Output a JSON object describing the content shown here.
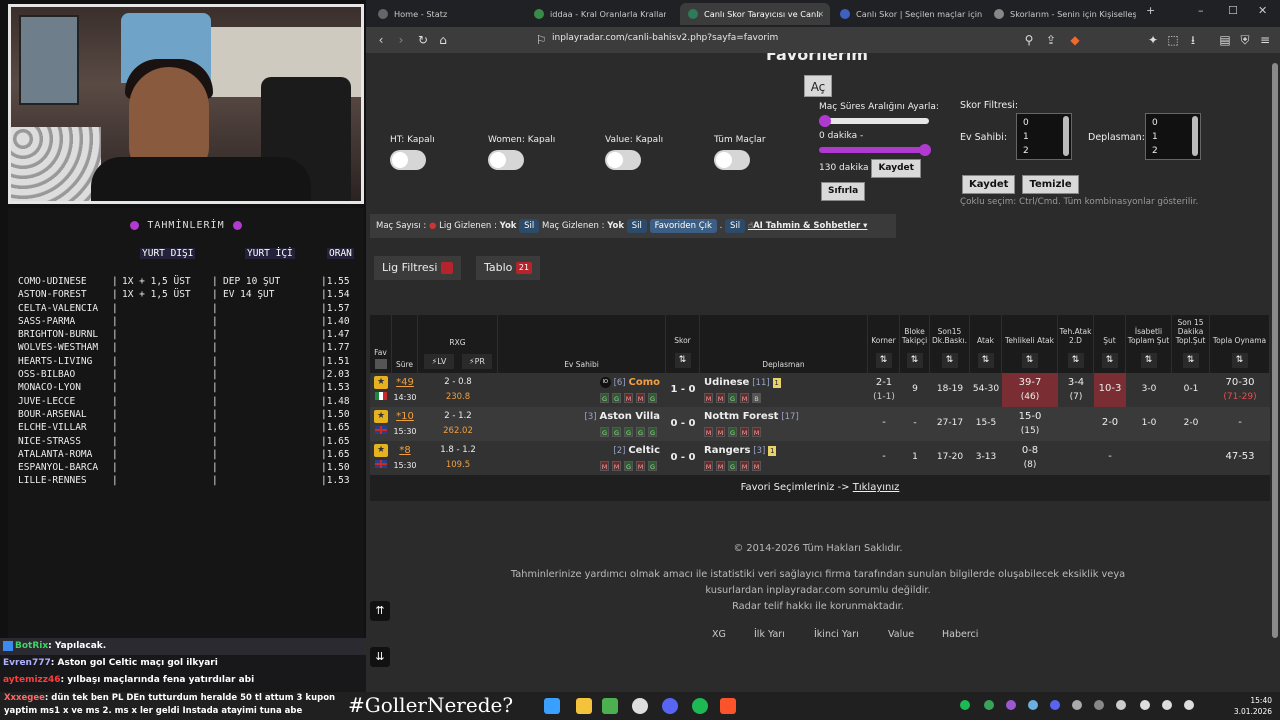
{
  "tahminlerim": {
    "title": "TAHMİNLERİM",
    "headers": {
      "yurt_disi": "YURT DIŞI",
      "yurt_ici": "YURT İÇİ",
      "oran": "ORAN"
    },
    "rows": [
      {
        "match": "COMO-UDINESE",
        "sep1": "|",
        "yd": "1X + 1,5 ÜST",
        "sep2": "|",
        "yi": "DEP 10 ŞUT",
        "oran": "|1.55"
      },
      {
        "match": "ASTON-FOREST",
        "sep1": "|",
        "yd": "1X + 1,5 ÜST",
        "sep2": "|",
        "yi": "EV 14 ŞUT",
        "oran": "|1.54"
      },
      {
        "match": "CELTA-VALENCIA",
        "sep1": "|",
        "yd": "",
        "sep2": "|",
        "yi": "",
        "oran": "|1.57"
      },
      {
        "match": "SASS-PARMA",
        "sep1": "|",
        "yd": "",
        "sep2": "|",
        "yi": "",
        "oran": "|1.40"
      },
      {
        "match": "BRIGHTON-BURNL",
        "sep1": "|",
        "yd": "",
        "sep2": "|",
        "yi": "",
        "oran": "|1.47"
      },
      {
        "match": "WOLVES-WESTHAM",
        "sep1": "|",
        "yd": "",
        "sep2": "|",
        "yi": "",
        "oran": "|1.77"
      },
      {
        "match": "HEARTS-LIVING",
        "sep1": "|",
        "yd": "",
        "sep2": "|",
        "yi": "",
        "oran": "|1.51"
      },
      {
        "match": "OSS-BILBAO",
        "sep1": "|",
        "yd": "",
        "sep2": "|",
        "yi": "",
        "oran": "|2.03"
      },
      {
        "match": "MONACO-LYON",
        "sep1": "|",
        "yd": "",
        "sep2": "|",
        "yi": "",
        "oran": "|1.53"
      },
      {
        "match": "JUVE-LECCE",
        "sep1": "|",
        "yd": "",
        "sep2": "|",
        "yi": "",
        "oran": "|1.48"
      },
      {
        "match": "BOUR-ARSENAL",
        "sep1": "|",
        "yd": "",
        "sep2": "|",
        "yi": "",
        "oran": "|1.50"
      },
      {
        "match": "ELCHE-VILLAR",
        "sep1": "|",
        "yd": "",
        "sep2": "|",
        "yi": "",
        "oran": "|1.65"
      },
      {
        "match": "NICE-STRASS",
        "sep1": "|",
        "yd": "",
        "sep2": "|",
        "yi": "",
        "oran": "|1.65"
      },
      {
        "match": "ATALANTA-ROMA",
        "sep1": "|",
        "yd": "",
        "sep2": "|",
        "yi": "",
        "oran": "|1.65"
      },
      {
        "match": "ESPANYOL-BARCA",
        "sep1": "|",
        "yd": "",
        "sep2": "|",
        "yi": "",
        "oran": "|1.50"
      },
      {
        "match": "LILLE-RENNES",
        "sep1": "|",
        "yd": "",
        "sep2": "|",
        "yi": "",
        "oran": "|1.53"
      }
    ]
  },
  "chat": [
    {
      "user": "BotRix",
      "msg": ": Yapılacak."
    },
    {
      "user": "Evren777",
      "msg": ": Aston gol Celtic maçı gol ilkyari"
    },
    {
      "user": "aytemizz46",
      "msg": ": yılbaşı maçlarında fena yatırdılar abi"
    }
  ],
  "taskbar": {
    "ticker_user": "Xxxegee",
    "ticker": ": dün tek ben PL DEn tutturdum heralde 50 tl attum 3 kupon yaptim ms1 x ve ms 2. ms x ler geldi Instada atayimi tuna abe",
    "hashtag": "#GollerNerede?",
    "time": "15:40",
    "date": "3.01.2026"
  },
  "browser": {
    "tabs": [
      {
        "label": "Home - Statz"
      },
      {
        "label": "iddaa - Kral Oranlarla Krallar Gibi"
      },
      {
        "label": "Canlı Skor Tarayıcısı ve Canlı"
      },
      {
        "label": "Canlı Skor | Seçilen maçlar için ca"
      },
      {
        "label": "Skorlarım - Senin için Kişiselleştiril"
      }
    ],
    "url": "inplayradar.com/canli-bahisv2.php?sayfa=favorim"
  },
  "page": {
    "title": "Favorilerim",
    "ac_button": "Aç",
    "toggles": [
      {
        "label": "HT: Kapalı"
      },
      {
        "label": "Women: Kapalı"
      },
      {
        "label": "Value: Kapalı"
      },
      {
        "label": "Tüm Maçlar"
      }
    ],
    "range": {
      "title": "Maç Süres Aralığını Ayarla:",
      "min_label": "0 dakika -",
      "max_label": "130 dakika",
      "min_value_min": 0,
      "max_value_min": 130,
      "save": "Kaydet",
      "reset": "Sıfırla"
    },
    "filter": {
      "title": "Skor Filtresi:",
      "home_label": "Ev Sahibi:",
      "away_label": "Deplasman:",
      "home_options": [
        "0",
        "1",
        "2"
      ],
      "away_options": [
        "0",
        "1",
        "2"
      ],
      "save": "Kaydet",
      "clear": "Temizle",
      "hint": "Çoklu seçim: Ctrl/Cmd. Tüm kombinasyonlar gösterilir."
    },
    "bar": {
      "mac_sayisi": "Maç Sayısı :",
      "lig_gizlenen": "Lig Gizlenen :",
      "lig_val": "Yok",
      "sil1": "Sil",
      "mac_gizlenen": "Maç Gizlenen :",
      "mac_val": "Yok",
      "sil2": "Sil",
      "favoriden": "Favoriden Çık",
      "dot": ".",
      "sil3": "Sil",
      "ai": "AI Tahmin & Sohbetler ▾"
    },
    "lig_filtresi": "Lig Filtresi",
    "tablo": "Tablo",
    "tablo_count": "21",
    "columns": {
      "fav": "Fav",
      "sure": "Süre",
      "rxg": "RXG",
      "lv": "LV",
      "pr": "PR",
      "ev": "Ev Sahibi",
      "skor": "Skor",
      "dep": "Deplasman",
      "korner": "Korner",
      "bloke": "Bloke Takipçi",
      "son15": "Son15 Dk.Baskı.",
      "atak": "Atak",
      "tehlikeli": "Tehlikeli Atak",
      "teh2d": "Teh.Atak 2.D",
      "sut": "Şut",
      "isabetli": "İsabetli Toplam Şut",
      "son15sut": "Son 15 Dakika Topl.Şut",
      "topla": "Topla Oynama"
    },
    "matches": [
      {
        "minute": "49",
        "time": "14:30",
        "rxg": "2 - 0.8",
        "xg": "230.8",
        "home": "Como",
        "home_rank": "[6]",
        "score": "1 - 0",
        "away": "Udinese",
        "away_rank": "[11]",
        "away_card": "1",
        "home_form": [
          "G",
          "G",
          "M",
          "M",
          "G"
        ],
        "away_form": [
          "M",
          "M",
          "G",
          "M",
          "B"
        ],
        "korner": "2-1",
        "korner_ht": "(1-1)",
        "bloke": "9",
        "son15": "18-19",
        "atak": "54-30",
        "tehlikeli": "39-7",
        "tehlikeli_ht": "(46)",
        "teh2d": "3-4",
        "teh2d_ht": "(7)",
        "sut": "10-3",
        "isabetli": "3-0",
        "son15sut": "0-1",
        "topla": "70-30",
        "topla_ht": "(71-29)"
      },
      {
        "minute": "10",
        "time": "15:30",
        "rxg": "2 - 1.2",
        "xg": "262.02",
        "home": "Aston Villa",
        "home_rank": "[3]",
        "score": "0 - 0",
        "away": "Nottm Forest",
        "away_rank": "[17]",
        "away_card": "",
        "home_form": [
          "G",
          "G",
          "G",
          "G",
          "G"
        ],
        "away_form": [
          "M",
          "M",
          "G",
          "M",
          "M"
        ],
        "korner": "-",
        "korner_ht": "",
        "bloke": "-",
        "son15": "27-17",
        "atak": "15-5",
        "tehlikeli": "15-0",
        "tehlikeli_ht": "(15)",
        "teh2d": "",
        "teh2d_ht": "",
        "sut": "2-0",
        "isabetli": "1-0",
        "son15sut": "2-0",
        "topla": "-",
        "topla_ht": ""
      },
      {
        "minute": "8",
        "time": "15:30",
        "rxg": "1.8 - 1.2",
        "xg": "109.5",
        "home": "Celtic",
        "home_rank": "[2]",
        "score": "0 - 0",
        "away": "Rangers",
        "away_rank": "[3]",
        "away_card": "1",
        "home_form": [
          "M",
          "M",
          "G",
          "M",
          "G"
        ],
        "away_form": [
          "M",
          "M",
          "G",
          "M",
          "M"
        ],
        "korner": "-",
        "korner_ht": "",
        "bloke": "1",
        "son15": "17-20",
        "atak": "3-13",
        "tehlikeli": "0-8",
        "tehlikeli_ht": "(8)",
        "teh2d": "",
        "teh2d_ht": "",
        "sut": "-",
        "isabetli": "",
        "son15sut": "",
        "topla": "47-53",
        "topla_ht": ""
      }
    ],
    "fav_footer": "Favori Seçimleriniz ->",
    "fav_footer_link": "Tıklayınız",
    "copyright": "© 2014-2026 Tüm Hakları Saklıdır.",
    "disclaimer1": "Tahminlerinize yardımcı olmak amacı ile istatistiki veri sağlayıcı firma tarafından sunulan bilgilerde oluşabilecek eksiklik veya",
    "disclaimer2": "kusurlardan inplayradar.com sorumlu değildir.",
    "disclaimer3": "Radar telif hakkı ile korunmaktadır.",
    "footer_links": [
      "XG",
      "İlk Yarı",
      "İkinci Yarı",
      "Value",
      "Haberci"
    ]
  },
  "colors": {
    "accent": "#b03ad0",
    "danger": "#7a2e33",
    "star": "#e7b21f"
  }
}
